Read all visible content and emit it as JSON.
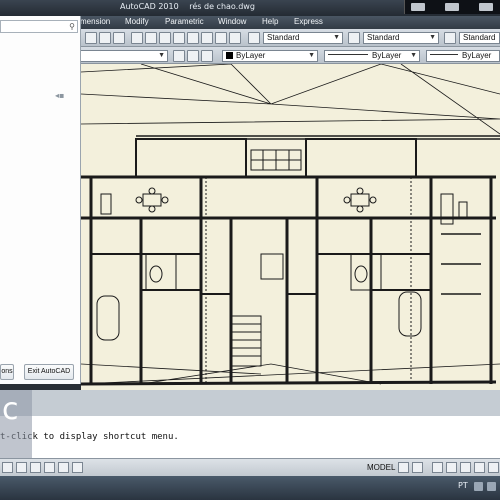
{
  "titlebar": {
    "app_name": "AutoCAD 2010",
    "document": "rés de chao.dwg"
  },
  "menu": {
    "items": [
      "mension",
      "Modify",
      "Parametric",
      "Window",
      "Help",
      "Express"
    ]
  },
  "toolbar1": {
    "text_style": "Standard",
    "dim_style": "Standard",
    "table_style": "Standard"
  },
  "toolbar2": {
    "color": "ByLayer",
    "linetype": "ByLayer",
    "lineweight": "ByLayer"
  },
  "left_panel": {
    "options_button": "ons",
    "exit_button": "Exit AutoCAD"
  },
  "command": {
    "prompt": "t-click to display shortcut menu."
  },
  "status": {
    "model_label": "MODEL"
  },
  "taskbar": {
    "language": "PT"
  },
  "colors": {
    "canvas_bg": "#f3f0dc",
    "ink": "#1a1a1a"
  }
}
